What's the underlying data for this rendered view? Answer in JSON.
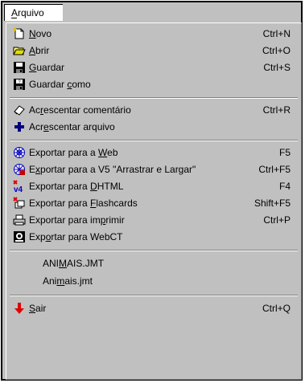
{
  "menubar": {
    "title": "Arquivo"
  },
  "items": [
    {
      "id": "novo",
      "pre": "",
      "mn": "N",
      "post": "ovo",
      "shortcut": "Ctrl+N",
      "icon": "new-document-icon"
    },
    {
      "id": "abrir",
      "pre": "",
      "mn": "A",
      "post": "brir",
      "shortcut": "Ctrl+O",
      "icon": "open-folder-icon"
    },
    {
      "id": "guardar",
      "pre": "",
      "mn": "G",
      "post": "uardar",
      "shortcut": "Ctrl+S",
      "icon": "save-disk-icon"
    },
    {
      "id": "guardar-como",
      "pre": "Guardar ",
      "mn": "c",
      "post": "omo",
      "shortcut": "",
      "icon": "save-as-icon"
    },
    {
      "id": "acrescentar-comentario",
      "pre": "Ac",
      "mn": "r",
      "post": "escentar comentário",
      "shortcut": "Ctrl+R",
      "icon": "eraser-icon"
    },
    {
      "id": "acrescentar-arquivo",
      "pre": "Acr",
      "mn": "e",
      "post": "scentar arquivo",
      "shortcut": "",
      "icon": "plus-icon"
    },
    {
      "id": "exportar-web",
      "pre": "Exportar para a ",
      "mn": "W",
      "post": "eb",
      "shortcut": "F5",
      "icon": "web-icon"
    },
    {
      "id": "exportar-v5",
      "pre": "E",
      "mn": "x",
      "post": "portar para a V5 \"Arrastrar e Largar\"",
      "shortcut": "Ctrl+F5",
      "icon": "web-v5-icon"
    },
    {
      "id": "exportar-dhtml",
      "pre": "Exportar para ",
      "mn": "D",
      "post": "HTML",
      "shortcut": "F4",
      "icon": "v4-icon"
    },
    {
      "id": "exportar-flashcards",
      "pre": "Exportar para ",
      "mn": "F",
      "post": "lashcards",
      "shortcut": "Shift+F5",
      "icon": "flashcards-icon"
    },
    {
      "id": "exportar-imprimir",
      "pre": "Exportar para  im",
      "mn": "p",
      "post": "rimir",
      "shortcut": "Ctrl+P",
      "icon": "printer-icon"
    },
    {
      "id": "exportar-webct",
      "pre": "Exp",
      "mn": "o",
      "post": "rtar para WebCT",
      "shortcut": "",
      "icon": "webct-icon"
    },
    {
      "id": "recent-1",
      "pre": "ANI",
      "mn": "M",
      "post": "AIS.JMT",
      "shortcut": "",
      "icon": ""
    },
    {
      "id": "recent-2",
      "pre": "Ani",
      "mn": "m",
      "post": "ais.jmt",
      "shortcut": "",
      "icon": ""
    },
    {
      "id": "sair",
      "pre": "",
      "mn": "S",
      "post": "air",
      "shortcut": "Ctrl+Q",
      "icon": "exit-arrow-icon"
    }
  ]
}
